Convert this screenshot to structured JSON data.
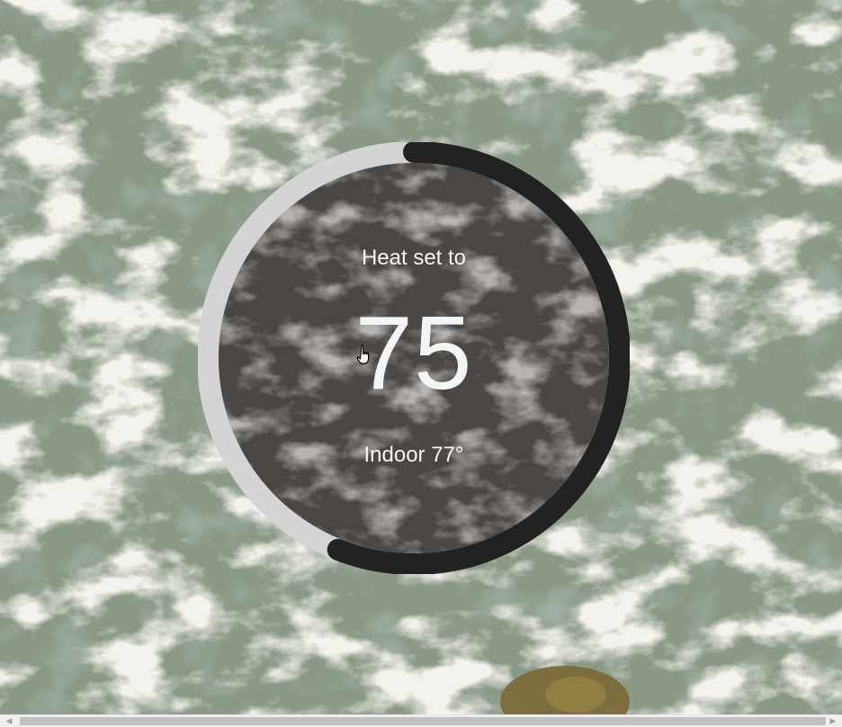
{
  "thermostat": {
    "mode_label": "Heat set to",
    "setpoint": "75",
    "indoor_label": "Indoor 77°",
    "dial_fill_fraction": 0.56,
    "colors": {
      "ring_track": "#d4d4d4",
      "ring_active": "#222222",
      "face": "#4a4643",
      "text": "#f5f5f5"
    }
  },
  "background": {
    "scene": "water-foam-texture",
    "colors": {
      "water": "#7f8f7a",
      "foam": "#e6e2d6"
    }
  },
  "cursor": {
    "icon": "hand-pointer-icon"
  },
  "scrollbar": {
    "left_icon": "arrow-left-icon",
    "right_icon": "arrow-right-icon"
  }
}
